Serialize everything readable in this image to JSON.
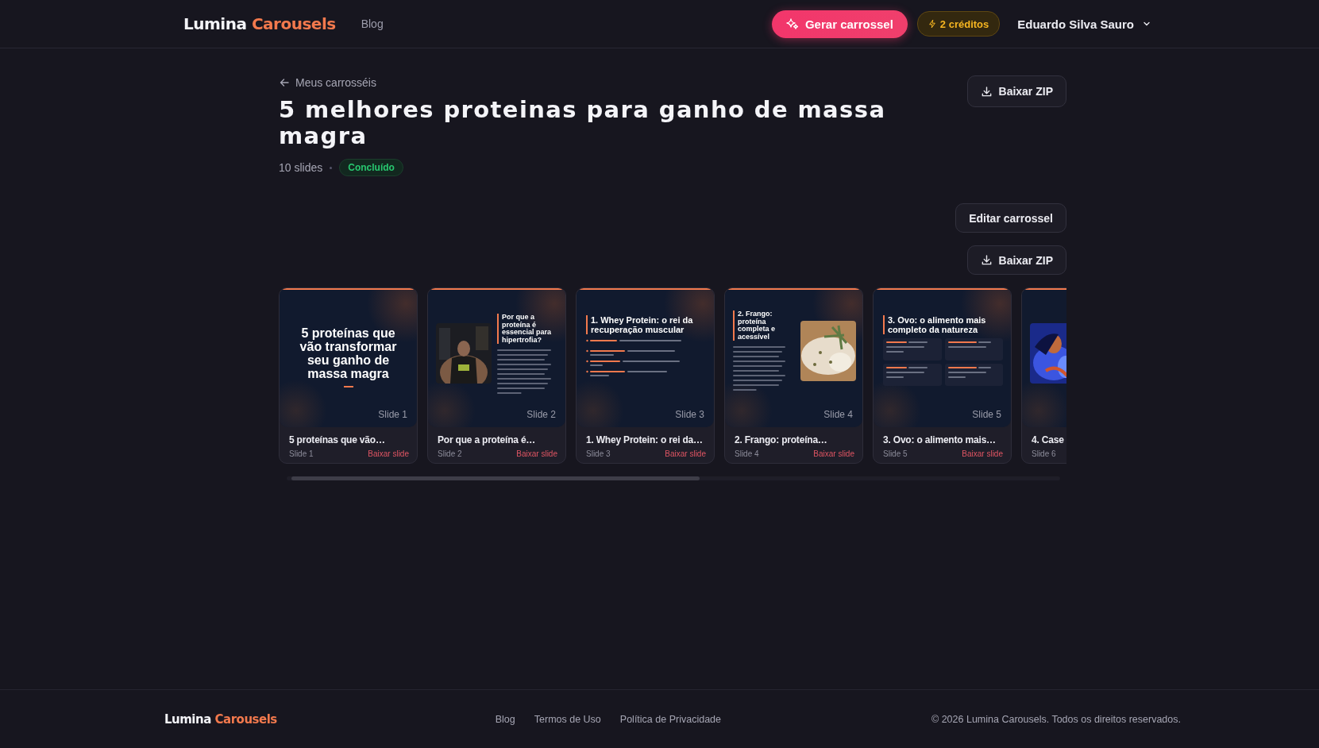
{
  "header": {
    "logo": {
      "first": "Lumina",
      "second": "Carousels"
    },
    "nav": [
      {
        "label": "Blog"
      }
    ],
    "generate_button": "Gerar carrossel",
    "credits": "2 créditos",
    "user": "Eduardo Silva Sauro"
  },
  "back_link": "Meus carrosséis",
  "top_download": "Baixar ZIP",
  "title": "5 melhores proteinas para ganho de massa magra",
  "slide_count": "10 slides",
  "status": "Concluído",
  "edit_button": "Editar carrossel",
  "download_zip": "Baixar ZIP",
  "slides": [
    {
      "kind": "cover",
      "heading": "5 proteínas que vão transformar seu ganho de massa magra",
      "label": "Slide 1",
      "title": "5 proteínas que vão…",
      "caption": "Slide 1",
      "download": "Baixar slide"
    },
    {
      "kind": "image_left",
      "heading": "Por que a proteína é essencial para hipertrofia?",
      "label": "Slide 2",
      "title": "Por que a proteína é…",
      "caption": "Slide 2",
      "download": "Baixar slide"
    },
    {
      "kind": "bullets",
      "heading": "1. Whey Protein: o rei da recuperação muscular",
      "label": "Slide 3",
      "title": "1. Whey Protein: o rei da…",
      "caption": "Slide 3",
      "download": "Baixar slide"
    },
    {
      "kind": "image_right",
      "heading": "2. Frango: proteína completa e acessível",
      "label": "Slide 4",
      "title": "2. Frango: proteína…",
      "caption": "Slide 4",
      "download": "Baixar slide"
    },
    {
      "kind": "grid",
      "heading": "3. Ovo: o alimento mais completo da natureza",
      "label": "Slide 5",
      "title": "3. Ovo: o alimento mais…",
      "caption": "Slide 5",
      "download": "Baixar slide"
    },
    {
      "kind": "image_left",
      "title": "4. Case",
      "caption": "Slide 6"
    }
  ],
  "footer": {
    "logo": {
      "first": "Lumina",
      "second": "Carousels"
    },
    "links": [
      "Blog",
      "Termos de Uso",
      "Política de Privacidade"
    ],
    "copyright": "© 2026 Lumina Carousels. Todos os direitos reservados."
  }
}
